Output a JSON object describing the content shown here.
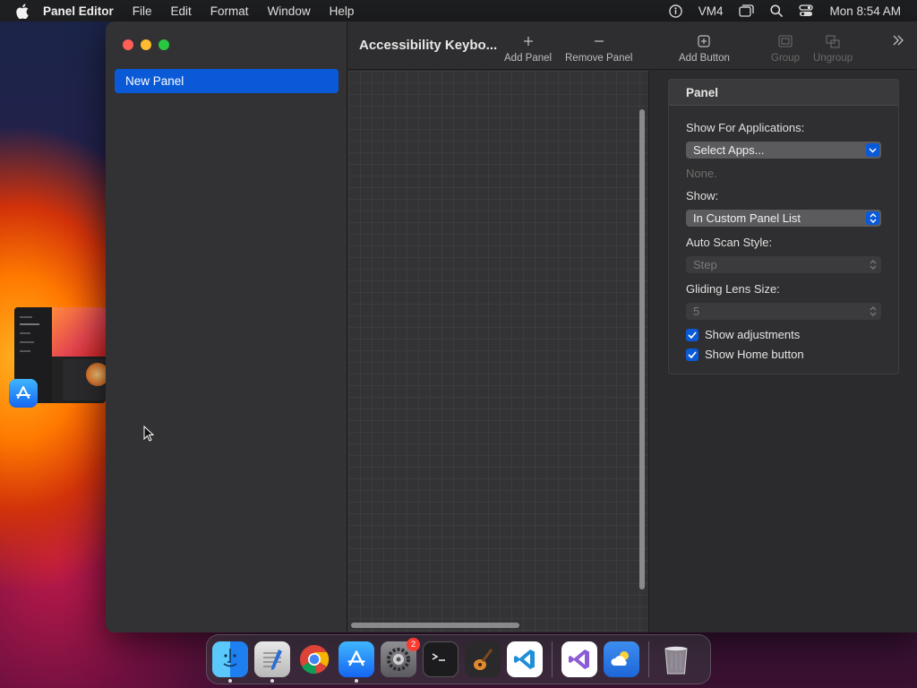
{
  "menubar": {
    "app_name": "Panel Editor",
    "items": [
      "File",
      "Edit",
      "Format",
      "Window",
      "Help"
    ],
    "status_vm": "VM4",
    "clock": "Mon 8:54 AM"
  },
  "sidebar": {
    "panels": [
      {
        "label": "New Panel",
        "selected": true
      }
    ]
  },
  "toolbar": {
    "title": "Accessibility Keybo...",
    "add_panel": "Add Panel",
    "remove_panel": "Remove Panel",
    "add_button": "Add Button",
    "group": "Group",
    "ungroup": "Ungroup"
  },
  "inspector": {
    "header": "Panel",
    "show_for_apps_label": "Show For Applications:",
    "select_apps_value": "Select Apps...",
    "apps_hint": "None.",
    "show_label": "Show:",
    "show_value": "In Custom Panel List",
    "auto_scan_label": "Auto Scan Style:",
    "auto_scan_value": "Step",
    "lens_label": "Gliding Lens Size:",
    "lens_value": "5",
    "show_adjustments": {
      "label": "Show adjustments",
      "checked": true
    },
    "show_home": {
      "label": "Show Home button",
      "checked": true
    }
  },
  "dock": {
    "apps": [
      "Finder",
      "TextEdit",
      "Chrome",
      "App Store",
      "System Settings",
      "Terminal",
      "GarageBand",
      "VS Code",
      "Visual Studio",
      "Weather",
      "Trash"
    ],
    "settings_badge": "2"
  },
  "colors": {
    "accent": "#0a5ad8",
    "window_bg": "#2b2b2d",
    "close": "#ff5f57",
    "minimize": "#febc2e",
    "zoom": "#28c840"
  }
}
